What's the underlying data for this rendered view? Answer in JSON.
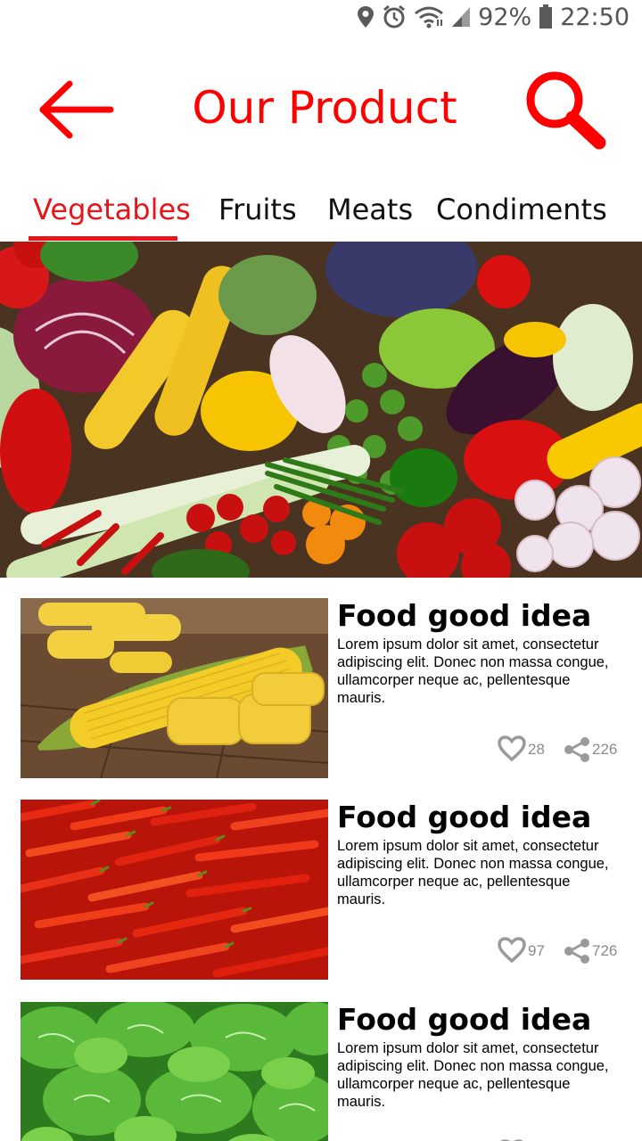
{
  "status_bar": {
    "battery": "92%",
    "time": "22:50",
    "icons": [
      "location-icon",
      "alarm-icon",
      "wifi-icon",
      "signal-icon",
      "battery-icon"
    ]
  },
  "header": {
    "title": "Our Product",
    "back_icon": "arrow-left-icon",
    "search_icon": "search-icon",
    "accent_color": "#ff0000"
  },
  "tabs": [
    {
      "label": "Vegetables",
      "active": true
    },
    {
      "label": "Fruits",
      "active": false
    },
    {
      "label": "Meats",
      "active": false
    },
    {
      "label": "Condiments",
      "active": false
    }
  ],
  "products": [
    {
      "title": "Food good idea",
      "description": "Lorem ipsum dolor sit amet, consectetur adipiscing elit. Donec non massa congue, ullamcorper neque ac, pellentesque mauris.",
      "likes": "28",
      "shares": "226",
      "image": "corn"
    },
    {
      "title": "Food good idea",
      "description": "Lorem ipsum dolor sit amet, consectetur adipiscing elit. Donec non massa congue, ullamcorper neque ac, pellentesque mauris.",
      "likes": "97",
      "shares": "726",
      "image": "chili-peppers"
    },
    {
      "title": "Food good idea",
      "description": "Lorem ipsum dolor sit amet, consectetur adipiscing elit. Donec non massa congue, ullamcorper neque ac, pellentesque mauris.",
      "likes": "",
      "shares": "",
      "image": "lettuce"
    }
  ]
}
